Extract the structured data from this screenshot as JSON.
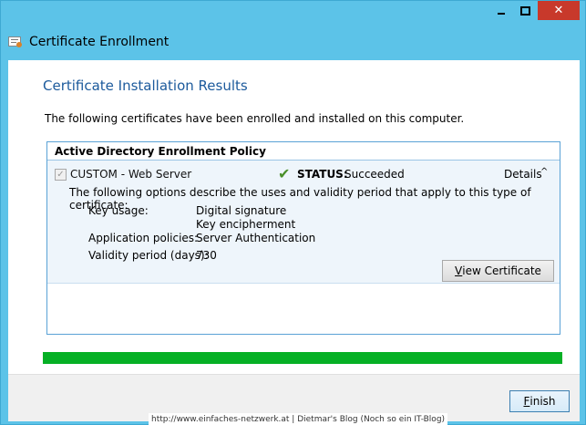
{
  "window": {
    "title": "Certificate Enrollment",
    "controls": {
      "minimize": "minimize",
      "maximize": "maximize",
      "close": "✕"
    }
  },
  "page": {
    "title": "Certificate Installation Results",
    "intro": "The following certificates have been enrolled and installed on this computer."
  },
  "policy": {
    "header": "Active Directory Enrollment Policy",
    "certificate": {
      "checked": true,
      "name": "CUSTOM - Web Server",
      "status_label": "STATUS:",
      "status_value": "Succeeded",
      "details_label": "Details",
      "description": "The following options describe the uses and validity period that apply to this type of certificate:",
      "key_usage_label": "Key usage:",
      "key_usage_values": [
        "Digital signature",
        "Key encipherment"
      ],
      "app_policies_label": "Application policies:",
      "app_policies_value": "Server Authentication",
      "validity_label": "Validity period (days):",
      "validity_value": "730",
      "view_button": {
        "accel": "V",
        "rest": "iew Certificate"
      }
    }
  },
  "progress": {
    "value": 1.0,
    "color": "#06b025"
  },
  "footer": {
    "finish_button": {
      "accel": "F",
      "rest": "inish"
    }
  },
  "watermark": "http://www.einfaches-netzwerk.at | Dietmar's Blog (Noch so ein IT-Blog)"
}
